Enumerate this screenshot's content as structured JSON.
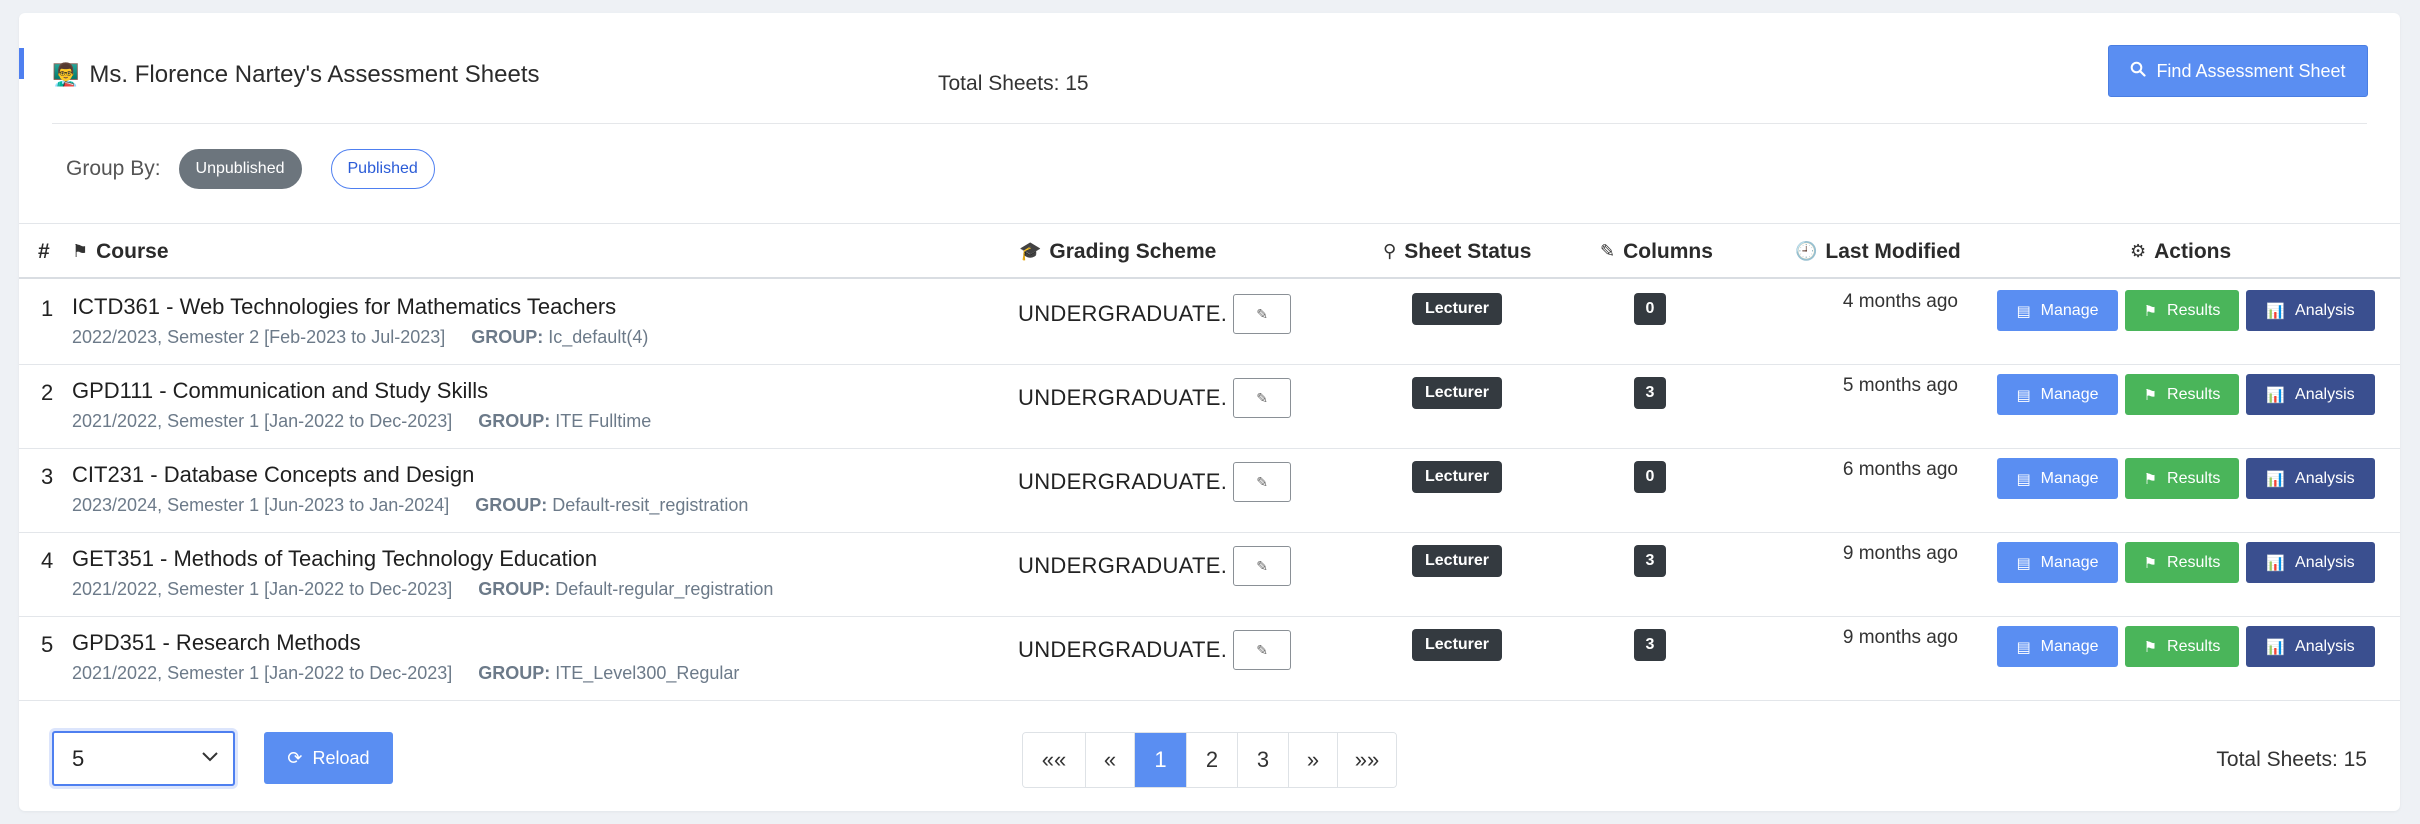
{
  "header": {
    "icon": "user-tie-icon",
    "title": "Ms. Florence Nartey's Assessment Sheets",
    "total_text": "Total Sheets: 15",
    "find_button": "Find Assessment Sheet"
  },
  "group_by": {
    "label": "Group By:",
    "options": [
      "Unpublished",
      "Published"
    ],
    "selected": "Unpublished"
  },
  "table": {
    "headers": {
      "num": "#",
      "course": "Course",
      "scheme": "Grading Scheme",
      "status": "Sheet Status",
      "columns": "Columns",
      "modified": "Last Modified",
      "actions": "Actions"
    },
    "rows": [
      {
        "num": "1",
        "title": "ICTD361 - Web Technologies for Mathematics Teachers",
        "session": "2022/2023, Semester 2 [Feb-2023 to Jul-2023]",
        "group_label": "GROUP:",
        "group": "Ic_default(4)",
        "scheme": "UNDERGRADUATE.",
        "status": "Lecturer",
        "columns": "0",
        "modified": "4 months ago"
      },
      {
        "num": "2",
        "title": "GPD111 - Communication and Study Skills",
        "session": "2021/2022, Semester 1 [Jan-2022 to Dec-2023]",
        "group_label": "GROUP:",
        "group": "ITE Fulltime",
        "scheme": "UNDERGRADUATE.",
        "status": "Lecturer",
        "columns": "3",
        "modified": "5 months ago"
      },
      {
        "num": "3",
        "title": "CIT231 - Database Concepts and Design",
        "session": "2023/2024, Semester 1 [Jun-2023 to Jan-2024]",
        "group_label": "GROUP:",
        "group": "Default-resit_registration",
        "scheme": "UNDERGRADUATE.",
        "status": "Lecturer",
        "columns": "0",
        "modified": "6 months ago"
      },
      {
        "num": "4",
        "title": "GET351 - Methods of Teaching Technology Education",
        "session": "2021/2022, Semester 1 [Jan-2022 to Dec-2023]",
        "group_label": "GROUP:",
        "group": "Default-regular_registration",
        "scheme": "UNDERGRADUATE.",
        "status": "Lecturer",
        "columns": "3",
        "modified": "9 months ago"
      },
      {
        "num": "5",
        "title": "GPD351 - Research Methods",
        "session": "2021/2022, Semester 1 [Jan-2022 to Dec-2023]",
        "group_label": "GROUP:",
        "group": "ITE_Level300_Regular",
        "scheme": "UNDERGRADUATE.",
        "status": "Lecturer",
        "columns": "3",
        "modified": "9 months ago"
      }
    ],
    "actions": {
      "manage": "Manage",
      "results": "Results",
      "analysis": "Analysis"
    }
  },
  "footer": {
    "page_size": "5",
    "reload": "Reload",
    "pages": [
      "«‹",
      "‹",
      "1",
      "2",
      "3",
      "›",
      "›»"
    ],
    "pager_labels": [
      "««",
      "«",
      "1",
      "2",
      "3",
      "»",
      "»»"
    ],
    "current_page": "1",
    "total_text": "Total Sheets: 15"
  },
  "colors": {
    "primary": "#5a8ef2",
    "success": "#4ab55a",
    "dark_blue": "#3a4f8f",
    "badge_dark": "#343a40"
  }
}
